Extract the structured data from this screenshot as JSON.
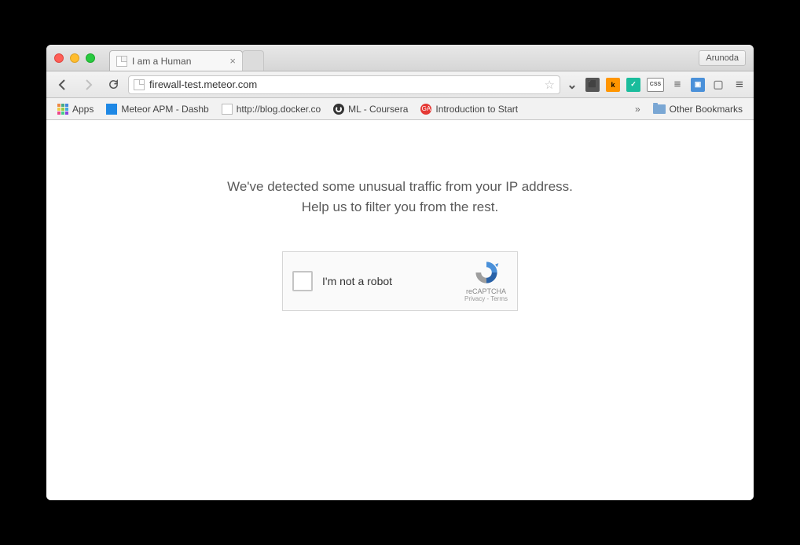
{
  "titlebar": {
    "tab_title": "I am a Human",
    "profile_name": "Arunoda"
  },
  "toolbar": {
    "url": "firewall-test.meteor.com"
  },
  "bookmarks": {
    "apps": "Apps",
    "items": [
      "Meteor APM - Dashb",
      "http://blog.docker.co",
      "ML - Coursera",
      "Introduction to Start"
    ],
    "overflow": "»",
    "other": "Other Bookmarks"
  },
  "page": {
    "line1": "We've detected some unusual traffic from your IP address.",
    "line2": "Help us to filter you from the rest.",
    "captcha_label": "I'm not a robot",
    "captcha_brand": "reCAPTCHA",
    "captcha_links": "Privacy - Terms"
  }
}
